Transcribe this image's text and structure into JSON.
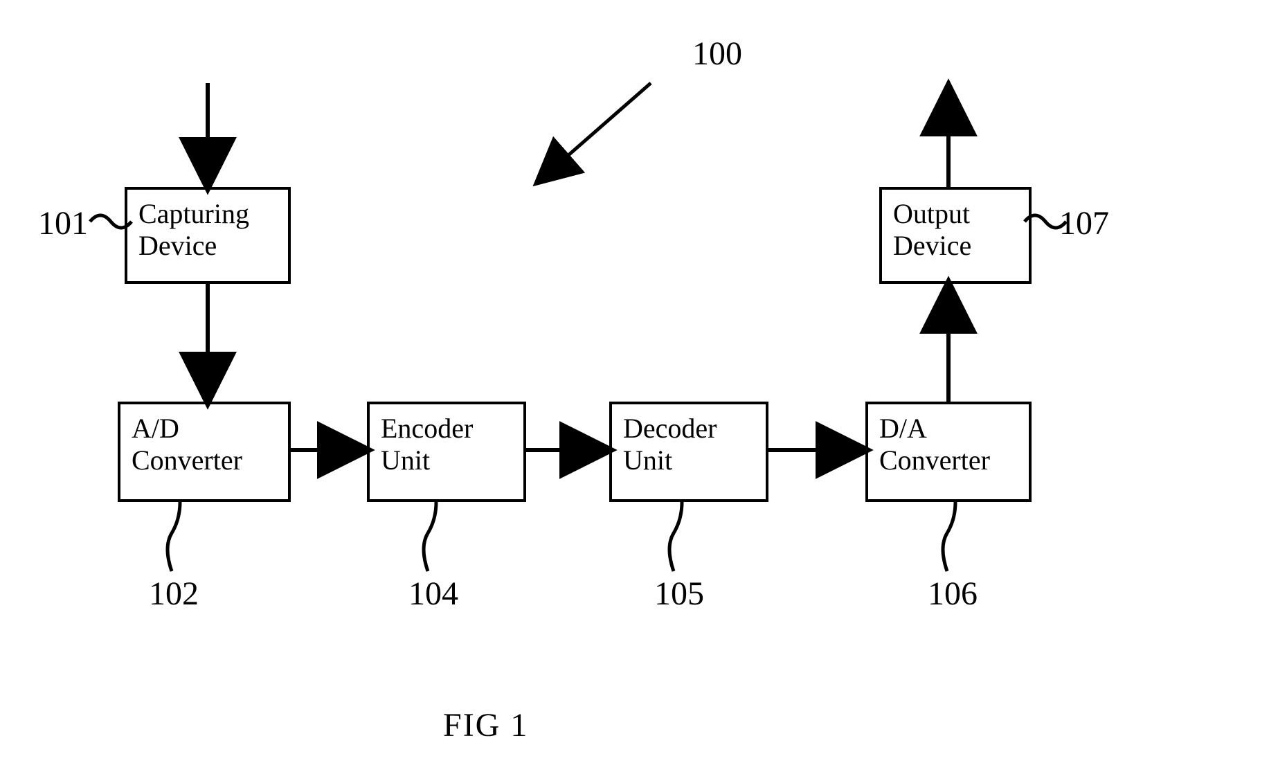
{
  "figure": {
    "caption": "FIG 1",
    "main_ref": "100"
  },
  "blocks": {
    "capturing_device": {
      "label": "Capturing\nDevice",
      "ref": "101"
    },
    "ad_converter": {
      "label": "A/D\nConverter",
      "ref": "102"
    },
    "encoder_unit": {
      "label": "Encoder\nUnit",
      "ref": "104"
    },
    "decoder_unit": {
      "label": "Decoder\nUnit",
      "ref": "105"
    },
    "da_converter": {
      "label": "D/A\nConverter",
      "ref": "106"
    },
    "output_device": {
      "label": "Output\nDevice",
      "ref": "107"
    }
  }
}
